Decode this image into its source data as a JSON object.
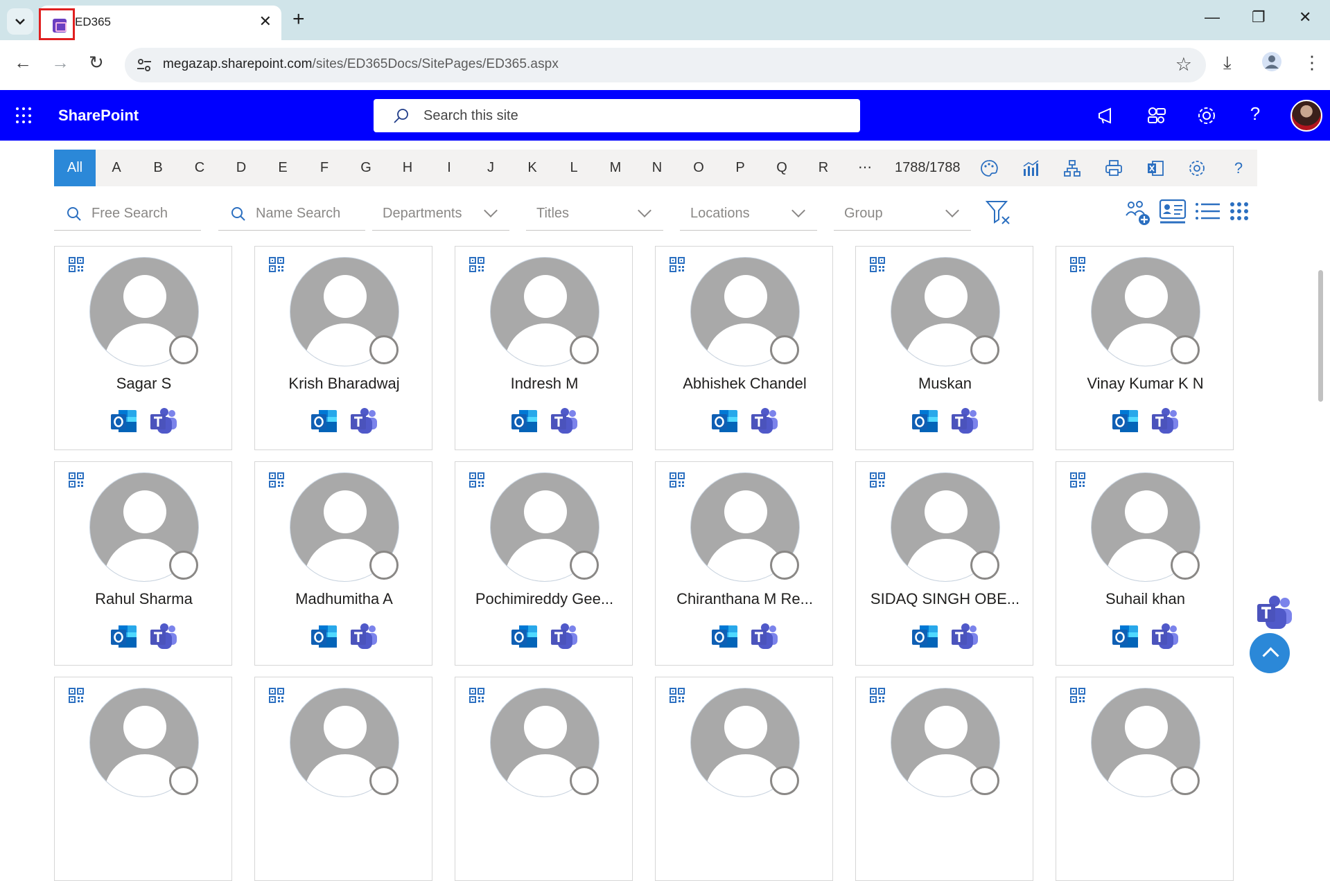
{
  "browser": {
    "tab_title": "ED365",
    "url_host": "megazap.sharepoint.com",
    "url_path": "/sites/ED365Docs/SitePages/ED365.aspx"
  },
  "suitebar": {
    "brand": "SharePoint",
    "search_placeholder": "Search this site"
  },
  "alphabet": {
    "letters": [
      "All",
      "A",
      "B",
      "C",
      "D",
      "E",
      "F",
      "G",
      "H",
      "I",
      "J",
      "K",
      "L",
      "M",
      "N",
      "O",
      "P",
      "Q",
      "R"
    ],
    "more": "⋯",
    "active": "All",
    "count": "1788/1788"
  },
  "filters": {
    "free_search": "Free Search",
    "name_search": "Name Search",
    "departments": "Departments",
    "titles": "Titles",
    "locations": "Locations",
    "group": "Group"
  },
  "people": [
    {
      "name": "Sagar S"
    },
    {
      "name": "Krish Bharadwaj"
    },
    {
      "name": "Indresh M"
    },
    {
      "name": "Abhishek Chandel"
    },
    {
      "name": "Muskan"
    },
    {
      "name": "Vinay Kumar K N"
    },
    {
      "name": "Rahul Sharma"
    },
    {
      "name": "Madhumitha A"
    },
    {
      "name": "Pochimireddy Gee..."
    },
    {
      "name": "Chiranthana M Re..."
    },
    {
      "name": "SIDAQ SINGH OBE..."
    },
    {
      "name": "Suhail khan"
    }
  ],
  "colors": {
    "suitebar": "#0000ff",
    "accent": "#2b88d8",
    "highlight_box": "#e01f1f"
  }
}
